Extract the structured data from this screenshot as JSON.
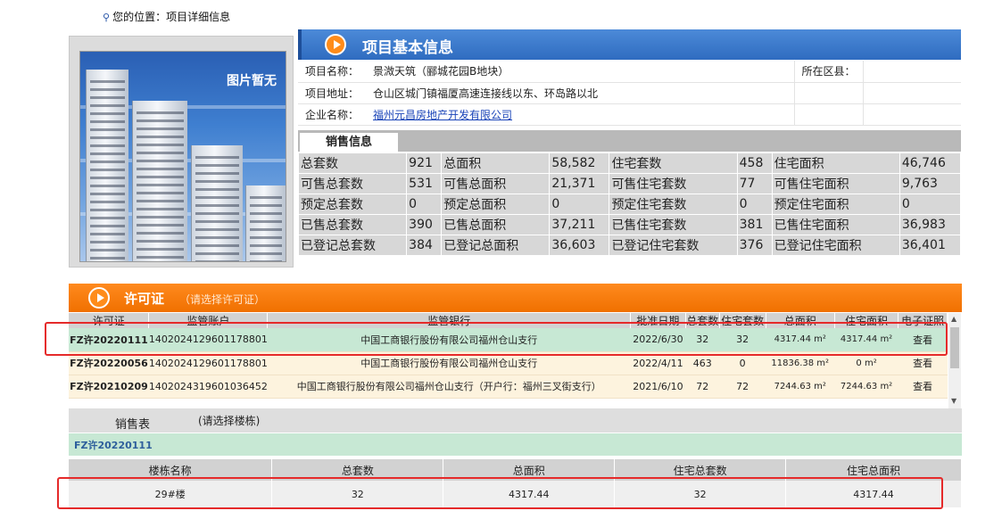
{
  "breadcrumb": {
    "prefix": "您的位置：",
    "current": "项目详细信息"
  },
  "photo": {
    "placeholder_text": "图片暂无"
  },
  "basic_info": {
    "title": "项目基本信息",
    "rows": [
      {
        "label": "项目名称：",
        "value": "景溦天筑（郦城花园B地块）",
        "extra_label": "所在区县：",
        "extra_value": ""
      },
      {
        "label": "项目地址：",
        "value": "仓山区城门镇福厦高速连接线以东、环岛路以北"
      },
      {
        "label": "企业名称：",
        "value": "福州元昌房地产开发有限公司"
      }
    ]
  },
  "sales_info": {
    "tab_label": "销售信息",
    "rows": [
      [
        "总套数",
        "921",
        "总面积",
        "58,582",
        "住宅套数",
        "458",
        "住宅面积",
        "46,746"
      ],
      [
        "可售总套数",
        "531",
        "可售总面积",
        "21,371",
        "可售住宅套数",
        "77",
        "可售住宅面积",
        "9,763"
      ],
      [
        "预定总套数",
        "0",
        "预定总面积",
        "0",
        "预定住宅套数",
        "0",
        "预定住宅面积",
        "0"
      ],
      [
        "已售总套数",
        "390",
        "已售总面积",
        "37,211",
        "已售住宅套数",
        "381",
        "已售住宅面积",
        "36,983"
      ],
      [
        "已登记总套数",
        "384",
        "已登记总面积",
        "36,603",
        "已登记住宅套数",
        "376",
        "已登记住宅面积",
        "36,401"
      ]
    ]
  },
  "permits": {
    "title": "许可证",
    "subtitle": "（请选择许可证）",
    "headers": [
      "许可证",
      "监管账户",
      "监管银行",
      "批准日期",
      "总套数",
      "住宅套数",
      "总面积",
      "住宅面积",
      "电子证照"
    ],
    "rows": [
      {
        "permit": "FZ许20220111",
        "account": "1402024129601178801",
        "bank": "中国工商银行股份有限公司福州仓山支行",
        "date": "2022/6/30",
        "total": "32",
        "res": "32",
        "area": "4317.44 m²",
        "res_area": "4317.44 m²",
        "action": "查看",
        "selected": true
      },
      {
        "permit": "FZ许20220056",
        "account": "1402024129601178801",
        "bank": "中国工商银行股份有限公司福州仓山支行",
        "date": "2022/4/11",
        "total": "463",
        "res": "0",
        "area": "11836.38 m²",
        "res_area": "0 m²",
        "action": "查看",
        "selected": false
      },
      {
        "permit": "FZ许20210209",
        "account": "1402024319601036452",
        "bank": "中国工商银行股份有限公司福州仓山支行（开户行：福州三叉街支行）",
        "date": "2021/6/10",
        "total": "72",
        "res": "72",
        "area": "7244.63 m²",
        "res_area": "7244.63 m²",
        "action": "查看",
        "selected": false
      }
    ]
  },
  "sales_table": {
    "label": "销售表",
    "hint": "(请选择楼栋)",
    "selected_permit": "FZ许20220111",
    "headers": [
      "楼栋名称",
      "总套数",
      "总面积",
      "住宅总套数",
      "住宅总面积"
    ],
    "rows": [
      [
        "29#楼",
        "32",
        "4317.44",
        "32",
        "4317.44"
      ]
    ]
  },
  "colors": {
    "highlight": "#e52a2a",
    "selected_row": "#c7e8d4",
    "orange_bar": "#f07000",
    "blue_bar": "#2f6cc0"
  }
}
